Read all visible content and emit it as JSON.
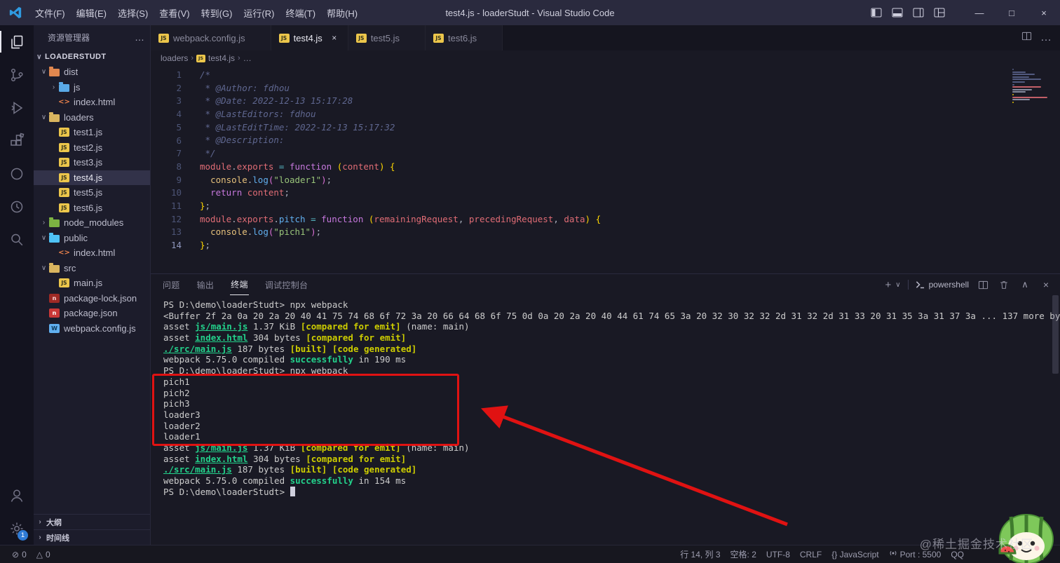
{
  "titlebar": {
    "menus": [
      "文件(F)",
      "编辑(E)",
      "选择(S)",
      "查看(V)",
      "转到(G)",
      "运行(R)",
      "终端(T)",
      "帮助(H)"
    ],
    "title": "test4.js - loaderStudt - Visual Studio Code"
  },
  "icons": {
    "minimize": "—",
    "maximize": "□",
    "close": "×",
    "more": "…",
    "plus": "+",
    "chevron_down": "∨",
    "chevron_up": "∧",
    "chevron_right": "›",
    "error": "⊘",
    "warning": "△",
    "breadcrumb_sep": "›"
  },
  "colors": {
    "annotation_red": "#e01212",
    "terminal_green": "#23d18b",
    "terminal_yellow": "#cdcd00",
    "js_icon": "#ecc64b",
    "badge_blue": "#2f7bd6"
  },
  "activitybar": {
    "top": [
      "explorer",
      "source-control",
      "run-debug",
      "extensions",
      "remote",
      "history",
      "search"
    ],
    "active": "explorer",
    "bottom": [
      "account",
      "settings"
    ],
    "settings_badge": "1"
  },
  "sidebar": {
    "title": "资源管理器",
    "section": "LOADERSTUDT",
    "tree": [
      {
        "label": "dist",
        "depth": 0,
        "kind": "folder",
        "icon": "f-dist",
        "chevron": "open"
      },
      {
        "label": "js",
        "depth": 1,
        "kind": "folder",
        "icon": "f-js",
        "chevron": "closed"
      },
      {
        "label": "index.html",
        "depth": 1,
        "kind": "file",
        "icon": "html",
        "glyph": "<>"
      },
      {
        "label": "loaders",
        "depth": 0,
        "kind": "folder",
        "icon": "f-plain",
        "chevron": "open"
      },
      {
        "label": "test1.js",
        "depth": 1,
        "kind": "file",
        "icon": "js",
        "glyph": "JS"
      },
      {
        "label": "test2.js",
        "depth": 1,
        "kind": "file",
        "icon": "js",
        "glyph": "JS"
      },
      {
        "label": "test3.js",
        "depth": 1,
        "kind": "file",
        "icon": "js",
        "glyph": "JS"
      },
      {
        "label": "test4.js",
        "depth": 1,
        "kind": "file",
        "icon": "js",
        "glyph": "JS",
        "selected": true
      },
      {
        "label": "test5.js",
        "depth": 1,
        "kind": "file",
        "icon": "js",
        "glyph": "JS"
      },
      {
        "label": "test6.js",
        "depth": 1,
        "kind": "file",
        "icon": "js",
        "glyph": "JS"
      },
      {
        "label": "node_modules",
        "depth": 0,
        "kind": "folder",
        "icon": "f-nm",
        "chevron": "closed"
      },
      {
        "label": "public",
        "depth": 0,
        "kind": "folder",
        "icon": "f-public",
        "chevron": "open"
      },
      {
        "label": "index.html",
        "depth": 1,
        "kind": "file",
        "icon": "html",
        "glyph": "<>"
      },
      {
        "label": "src",
        "depth": 0,
        "kind": "folder",
        "icon": "f-plain",
        "chevron": "open"
      },
      {
        "label": "main.js",
        "depth": 1,
        "kind": "file",
        "icon": "js",
        "glyph": "JS"
      },
      {
        "label": "package-lock.json",
        "depth": 0,
        "kind": "file",
        "icon": "npm2",
        "glyph": "n"
      },
      {
        "label": "package.json",
        "depth": 0,
        "kind": "file",
        "icon": "npm",
        "glyph": "n"
      },
      {
        "label": "webpack.config.js",
        "depth": 0,
        "kind": "file",
        "icon": "webpack",
        "glyph": "W"
      }
    ],
    "bottom_sections": [
      {
        "label": "大纲"
      },
      {
        "label": "时间线"
      }
    ]
  },
  "editor_tabs": [
    {
      "label": "webpack.config.js",
      "icon": "js",
      "glyph": "JS",
      "active": false
    },
    {
      "label": "test4.js",
      "icon": "js",
      "glyph": "JS",
      "active": true
    },
    {
      "label": "test5.js",
      "icon": "js",
      "glyph": "JS",
      "active": false
    },
    {
      "label": "test6.js",
      "icon": "js",
      "glyph": "JS",
      "active": false
    }
  ],
  "breadcrumb": [
    {
      "label": "loaders"
    },
    {
      "label": "test4.js",
      "icon": "js",
      "glyph": "JS"
    },
    {
      "label": "…"
    }
  ],
  "editor": {
    "cursor_line": 14,
    "lines": [
      {
        "n": 1,
        "seg": [
          {
            "t": "/*",
            "c": "cmt"
          }
        ]
      },
      {
        "n": 2,
        "seg": [
          {
            "t": " * @Author: fdhou",
            "c": "cmt"
          }
        ]
      },
      {
        "n": 3,
        "seg": [
          {
            "t": " * @Date: 2022-12-13 15:17:28",
            "c": "cmt"
          }
        ]
      },
      {
        "n": 4,
        "seg": [
          {
            "t": " * @LastEditors: fdhou",
            "c": "cmt"
          }
        ]
      },
      {
        "n": 5,
        "seg": [
          {
            "t": " * @LastEditTime: 2022-12-13 15:17:32",
            "c": "cmt"
          }
        ]
      },
      {
        "n": 6,
        "seg": [
          {
            "t": " * @Description:",
            "c": "cmt"
          }
        ]
      },
      {
        "n": 7,
        "seg": [
          {
            "t": " */",
            "c": "cmt"
          }
        ]
      },
      {
        "n": 8,
        "seg": [
          {
            "t": "module",
            "c": "red"
          },
          {
            "t": ".",
            "c": "white"
          },
          {
            "t": "exports",
            "c": "red"
          },
          {
            "t": " ",
            "c": "white"
          },
          {
            "t": "=",
            "c": "cyan"
          },
          {
            "t": " ",
            "c": "white"
          },
          {
            "t": "function",
            "c": "purple"
          },
          {
            "t": " ",
            "c": "white"
          },
          {
            "t": "(",
            "c": "brkt"
          },
          {
            "t": "content",
            "c": "red"
          },
          {
            "t": ")",
            "c": "brkt"
          },
          {
            "t": " ",
            "c": "white"
          },
          {
            "t": "{",
            "c": "brkt"
          }
        ]
      },
      {
        "n": 9,
        "seg": [
          {
            "t": "  ",
            "c": "white"
          },
          {
            "t": "console",
            "c": "yellow"
          },
          {
            "t": ".",
            "c": "white"
          },
          {
            "t": "log",
            "c": "blue"
          },
          {
            "t": "(",
            "c": "brkt2"
          },
          {
            "t": "\"loader1\"",
            "c": "green"
          },
          {
            "t": ")",
            "c": "brkt2"
          },
          {
            "t": ";",
            "c": "white"
          }
        ]
      },
      {
        "n": 10,
        "seg": [
          {
            "t": "  ",
            "c": "white"
          },
          {
            "t": "return",
            "c": "purple"
          },
          {
            "t": " ",
            "c": "white"
          },
          {
            "t": "content",
            "c": "red"
          },
          {
            "t": ";",
            "c": "white"
          }
        ]
      },
      {
        "n": 11,
        "seg": [
          {
            "t": "}",
            "c": "brkt"
          },
          {
            "t": ";",
            "c": "white"
          }
        ]
      },
      {
        "n": 12,
        "seg": [
          {
            "t": "module",
            "c": "red"
          },
          {
            "t": ".",
            "c": "white"
          },
          {
            "t": "exports",
            "c": "red"
          },
          {
            "t": ".",
            "c": "white"
          },
          {
            "t": "pitch",
            "c": "blue"
          },
          {
            "t": " ",
            "c": "white"
          },
          {
            "t": "=",
            "c": "cyan"
          },
          {
            "t": " ",
            "c": "white"
          },
          {
            "t": "function",
            "c": "purple"
          },
          {
            "t": " ",
            "c": "white"
          },
          {
            "t": "(",
            "c": "brkt"
          },
          {
            "t": "remainingRequest",
            "c": "red"
          },
          {
            "t": ",",
            "c": "white"
          },
          {
            "t": " ",
            "c": "white"
          },
          {
            "t": "precedingRequest",
            "c": "red"
          },
          {
            "t": ",",
            "c": "white"
          },
          {
            "t": " ",
            "c": "white"
          },
          {
            "t": "data",
            "c": "red"
          },
          {
            "t": ")",
            "c": "brkt"
          },
          {
            "t": " ",
            "c": "white"
          },
          {
            "t": "{",
            "c": "brkt"
          }
        ]
      },
      {
        "n": 13,
        "seg": [
          {
            "t": "  ",
            "c": "white"
          },
          {
            "t": "console",
            "c": "yellow"
          },
          {
            "t": ".",
            "c": "white"
          },
          {
            "t": "log",
            "c": "blue"
          },
          {
            "t": "(",
            "c": "brkt2"
          },
          {
            "t": "\"pich1\"",
            "c": "green"
          },
          {
            "t": ")",
            "c": "brkt2"
          },
          {
            "t": ";",
            "c": "white"
          }
        ]
      },
      {
        "n": 14,
        "seg": [
          {
            "t": "}",
            "c": "brkt"
          },
          {
            "t": ";",
            "c": "white"
          }
        ]
      }
    ]
  },
  "panel": {
    "tabs": [
      {
        "label": "问题",
        "active": false
      },
      {
        "label": "输出",
        "active": false
      },
      {
        "label": "终端",
        "active": true
      },
      {
        "label": "调试控制台",
        "active": false
      }
    ],
    "shell": "powershell",
    "terminal_lines": [
      {
        "seg": [
          {
            "t": "PS D:\\demo\\loaderStudt> "
          },
          {
            "t": "npx webpack"
          }
        ]
      },
      {
        "seg": [
          {
            "t": "<Buffer 2f 2a 0a 20 2a 20 40 41 75 74 68 6f 72 3a 20 66 64 68 6f 75 0d 0a 20 2a 20 40 44 61 74 65 3a 20 32 30 32 32 2d 31 32 2d 31 33 20 31 35 3a 31 37 3a ... 137 more bytes>"
          }
        ]
      },
      {
        "seg": [
          {
            "t": "asset "
          },
          {
            "t": "js/main.js",
            "c": "file"
          },
          {
            "t": " 1.37 KiB "
          },
          {
            "t": "[compared for emit]",
            "c": "yel"
          },
          {
            "t": " (name: main)"
          }
        ]
      },
      {
        "seg": [
          {
            "t": "asset "
          },
          {
            "t": "index.html",
            "c": "file"
          },
          {
            "t": " 304 bytes "
          },
          {
            "t": "[compared for emit]",
            "c": "yel"
          }
        ]
      },
      {
        "seg": [
          {
            "t": "./src/main.js",
            "c": "file"
          },
          {
            "t": " 187 bytes "
          },
          {
            "t": "[built]",
            "c": "yel"
          },
          {
            "t": " "
          },
          {
            "t": "[code generated]",
            "c": "yel"
          }
        ]
      },
      {
        "seg": [
          {
            "t": "webpack 5.75.0 compiled "
          },
          {
            "t": "successfully",
            "c": "ok"
          },
          {
            "t": " in 190 ms"
          }
        ]
      },
      {
        "seg": [
          {
            "t": "PS D:\\demo\\loaderStudt> "
          },
          {
            "t": "npx webpack"
          }
        ]
      },
      {
        "seg": [
          {
            "t": "pich1"
          }
        ]
      },
      {
        "seg": [
          {
            "t": "pich2"
          }
        ]
      },
      {
        "seg": [
          {
            "t": "pich3"
          }
        ]
      },
      {
        "seg": [
          {
            "t": "loader3"
          }
        ]
      },
      {
        "seg": [
          {
            "t": "loader2"
          }
        ]
      },
      {
        "seg": [
          {
            "t": "loader1"
          }
        ]
      },
      {
        "seg": [
          {
            "t": "asset "
          },
          {
            "t": "js/main.js",
            "c": "file"
          },
          {
            "t": " 1.37 KiB "
          },
          {
            "t": "[compared for emit]",
            "c": "yel"
          },
          {
            "t": " (name: main)"
          }
        ]
      },
      {
        "seg": [
          {
            "t": "asset "
          },
          {
            "t": "index.html",
            "c": "file"
          },
          {
            "t": " 304 bytes "
          },
          {
            "t": "[compared for emit]",
            "c": "yel"
          }
        ]
      },
      {
        "seg": [
          {
            "t": "./src/main.js",
            "c": "file"
          },
          {
            "t": " 187 bytes "
          },
          {
            "t": "[built]",
            "c": "yel"
          },
          {
            "t": " "
          },
          {
            "t": "[code generated]",
            "c": "yel"
          }
        ]
      },
      {
        "seg": [
          {
            "t": "webpack 5.75.0 compiled "
          },
          {
            "t": "successfully",
            "c": "ok"
          },
          {
            "t": " in 154 ms"
          }
        ]
      },
      {
        "seg": [
          {
            "t": "PS D:\\demo\\loaderStudt> "
          },
          {
            "t": "",
            "c": "cursor"
          }
        ]
      }
    ]
  },
  "statusbar": {
    "left": [
      {
        "icon": "error",
        "label": "0"
      },
      {
        "icon": "warning",
        "label": "0"
      }
    ],
    "right": [
      {
        "label": "行 14, 列 3"
      },
      {
        "label": "空格: 2"
      },
      {
        "label": "UTF-8"
      },
      {
        "label": "CRLF"
      },
      {
        "label": "{} JavaScript"
      },
      {
        "label": "Port : 5500",
        "icon": "port"
      },
      {
        "label": "QQ"
      }
    ]
  },
  "watermark": {
    "text": "@稀土掘金技术社区"
  }
}
